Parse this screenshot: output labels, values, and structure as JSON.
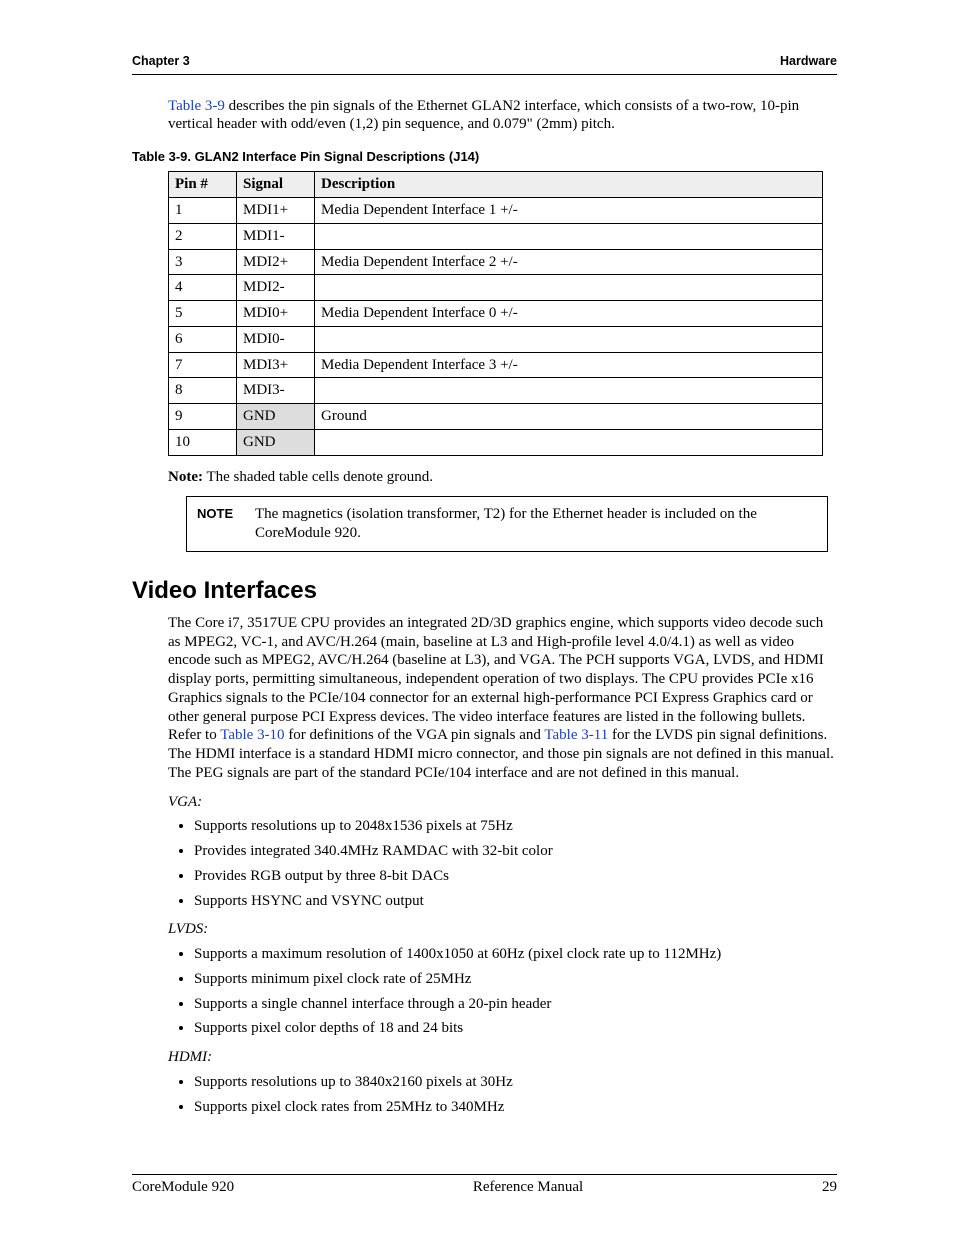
{
  "header": {
    "left": "Chapter 3",
    "right": "Hardware"
  },
  "intro": {
    "link": "Table 3-9",
    "rest": " describes the pin signals of the Ethernet GLAN2 interface, which consists of a two-row, 10-pin vertical header with odd/even (1,2) pin sequence, and 0.079\" (2mm) pitch."
  },
  "table": {
    "caption": "Table 3-9.   GLAN2 Interface Pin Signal Descriptions (J14)",
    "headers": [
      "Pin #",
      "Signal",
      "Description"
    ],
    "rows": [
      {
        "pin": "1",
        "signal": "MDI1+",
        "desc": "Media Dependent Interface 1 +/-",
        "shaded": false
      },
      {
        "pin": "2",
        "signal": "MDI1-",
        "desc": "",
        "shaded": false
      },
      {
        "pin": "3",
        "signal": "MDI2+",
        "desc": "Media Dependent Interface 2 +/-",
        "shaded": false
      },
      {
        "pin": "4",
        "signal": "MDI2-",
        "desc": "",
        "shaded": false
      },
      {
        "pin": "5",
        "signal": "MDI0+",
        "desc": "Media Dependent Interface 0 +/-",
        "shaded": false
      },
      {
        "pin": "6",
        "signal": "MDI0-",
        "desc": "",
        "shaded": false
      },
      {
        "pin": "7",
        "signal": "MDI3+",
        "desc": "Media Dependent Interface 3 +/-",
        "shaded": false
      },
      {
        "pin": "8",
        "signal": "MDI3-",
        "desc": "",
        "shaded": false
      },
      {
        "pin": "9",
        "signal": "GND",
        "desc": "Ground",
        "shaded": true
      },
      {
        "pin": "10",
        "signal": "GND",
        "desc": "",
        "shaded": true
      }
    ]
  },
  "note_line": {
    "label": "Note:",
    "text": "  The shaded table cells denote ground."
  },
  "note_box": {
    "label": "NOTE",
    "text": "The magnetics (isolation transformer, T2) for the Ethernet header is included on the CoreModule 920."
  },
  "section_title": "Video Interfaces",
  "video_para": {
    "pre": "The Core i7, 3517UE CPU provides an integrated 2D/3D graphics engine, which supports video decode such as MPEG2, VC-1, and AVC/H.264 (main, baseline at L3 and High-profile level 4.0/4.1) as well as video encode such as MPEG2, AVC/H.264 (baseline at L3), and VGA. The PCH supports VGA, LVDS, and HDMI display ports, permitting simultaneous, independent operation of two displays. The CPU provides PCIe x16 Graphics signals to the PCIe/104 connector for an external high-performance PCI Express Graphics card or other general purpose PCI Express devices. The video interface features are listed in the following bullets. Refer to ",
    "link1": "Table 3-10",
    "mid": " for definitions of the VGA pin signals and ",
    "link2": "Table 3-11",
    "post": " for the LVDS pin signal definitions. The HDMI interface is a standard HDMI micro connector, and those pin signals are not defined in this manual. The PEG signals are part of the standard PCIe/104 interface and are not defined in this manual."
  },
  "groups": [
    {
      "title": "VGA",
      "items": [
        "Supports resolutions up to 2048x1536 pixels at 75Hz",
        "Provides integrated 340.4MHz RAMDAC with 32-bit color",
        "Provides RGB output by three 8-bit DACs",
        "Supports HSYNC and VSYNC output"
      ]
    },
    {
      "title": "LVDS",
      "items": [
        "Supports a maximum resolution of 1400x1050 at 60Hz (pixel clock rate up to 112MHz)",
        "Supports minimum pixel clock rate of 25MHz",
        "Supports a single channel interface through a 20-pin header",
        "Supports pixel color depths of 18 and 24 bits"
      ]
    },
    {
      "title": "HDMI",
      "items": [
        "Supports resolutions up to 3840x2160 pixels at 30Hz",
        "Supports pixel clock rates from 25MHz to 340MHz"
      ]
    }
  ],
  "footer": {
    "left": "CoreModule 920",
    "center": "Reference Manual",
    "right": "29"
  }
}
